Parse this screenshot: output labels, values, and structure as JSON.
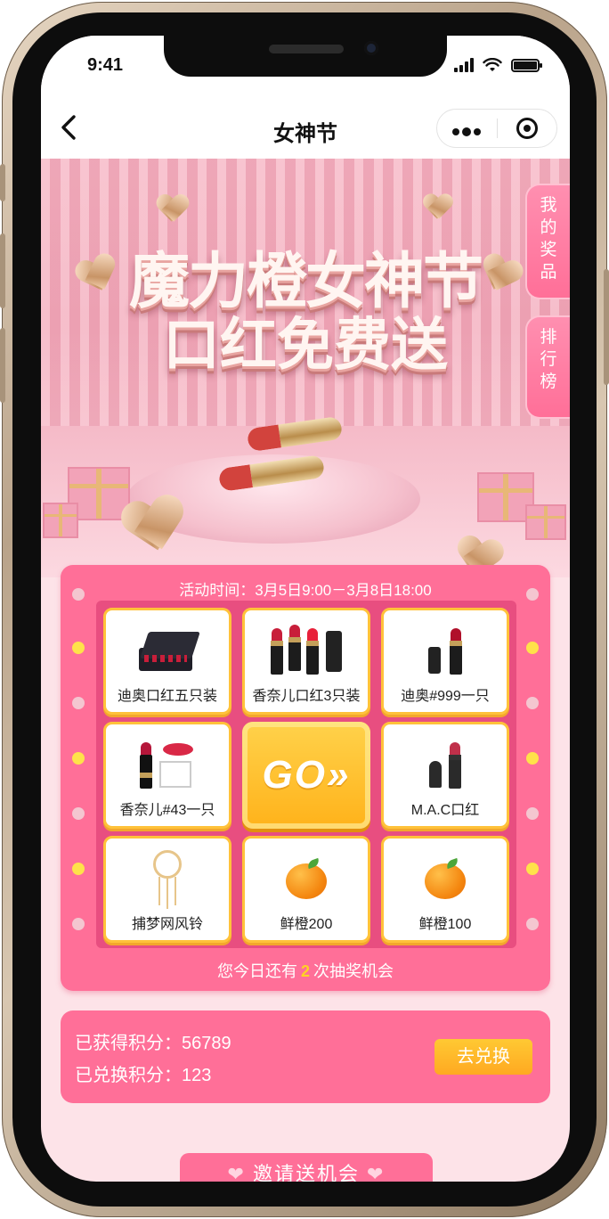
{
  "status_bar": {
    "time": "9:41"
  },
  "nav": {
    "title": "女神节",
    "back_icon": "chevron-left-icon",
    "more_icon": "more-dots-icon",
    "close_icon": "target-close-icon"
  },
  "banner": {
    "title_line1": "魔力橙女神节",
    "title_line2": "口红免费送"
  },
  "side_tabs": [
    {
      "label": "我的奖品"
    },
    {
      "label": "排行榜"
    }
  ],
  "lottery": {
    "activity_time": "活动时间：3月5日9:00－3月8日18:00",
    "go_label": "GO»",
    "prizes": [
      {
        "label": "迪奥口红五只装",
        "icon": "lipstick-box-set-icon"
      },
      {
        "label": "香奈儿口红3只装",
        "icon": "lipstick-set-icon"
      },
      {
        "label": "迪奥#999一只",
        "icon": "lipstick-icon"
      },
      {
        "label": "M.A.C口红",
        "icon": "lipstick-icon"
      },
      {
        "label": "鲜橙100",
        "icon": "orange-icon"
      },
      {
        "label": "鲜橙200",
        "icon": "orange-icon"
      },
      {
        "label": "捕梦网风铃",
        "icon": "dreamcatcher-icon"
      },
      {
        "label": "香奈儿#43一只",
        "icon": "lipstick-gift-icon"
      }
    ],
    "chance_prefix": "您今日还有",
    "chance_count": "2",
    "chance_suffix": "次抽奖机会"
  },
  "points": {
    "earned": "已获得积分：56789",
    "redeemed": "已兑换积分：123",
    "exchange_button": "去兑换"
  },
  "invite": {
    "label": "邀请送机会",
    "heart": "❤"
  },
  "colors": {
    "accent_pink": "#ff6f98",
    "board_pink": "#e84e80",
    "gold": "#ffc23a",
    "light_yellow": "#ffe24a"
  }
}
